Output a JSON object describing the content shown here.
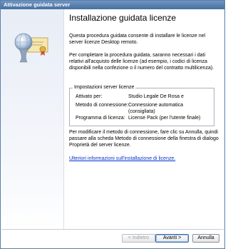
{
  "window": {
    "title": "Attivazione guidata server"
  },
  "main": {
    "heading": "Installazione guidata licenze",
    "intro": "Questa procedura guidata consente di installare le licenze nel server licenze Desktop remoto.",
    "info": "Per completare la procedura guidata, saranno necessari i dati relativi all'acquisto delle licenze (ad esempio, i codici di licenza disponibili nella confezione o il numero del contratto multilicenza).",
    "settings": {
      "legend": "Impostazioni server licenze",
      "rows": [
        {
          "label": "Attivato per:",
          "value": "Studio Legale De Rosa e"
        },
        {
          "label": "Metodo di connessione:",
          "value": "Connessione automatica (consigliata)"
        },
        {
          "label": "Programma di licenza:",
          "value": "License Pack (per l'utente finale)"
        }
      ]
    },
    "modify_note": "Per modificare il metodo di connessione, fare clic su Annulla, quindi passare alla scheda Metodo di connessione della finestra di dialogo Proprietà del server licenze.",
    "more_info_link": "Ulteriori informazioni sull'installazione di licenze."
  },
  "footer": {
    "back_label": "< Indietro",
    "next_label": "Avanti >",
    "cancel_label": "Annulla"
  },
  "icons": {
    "wizard_art": "certificate-with-globe-icon"
  }
}
